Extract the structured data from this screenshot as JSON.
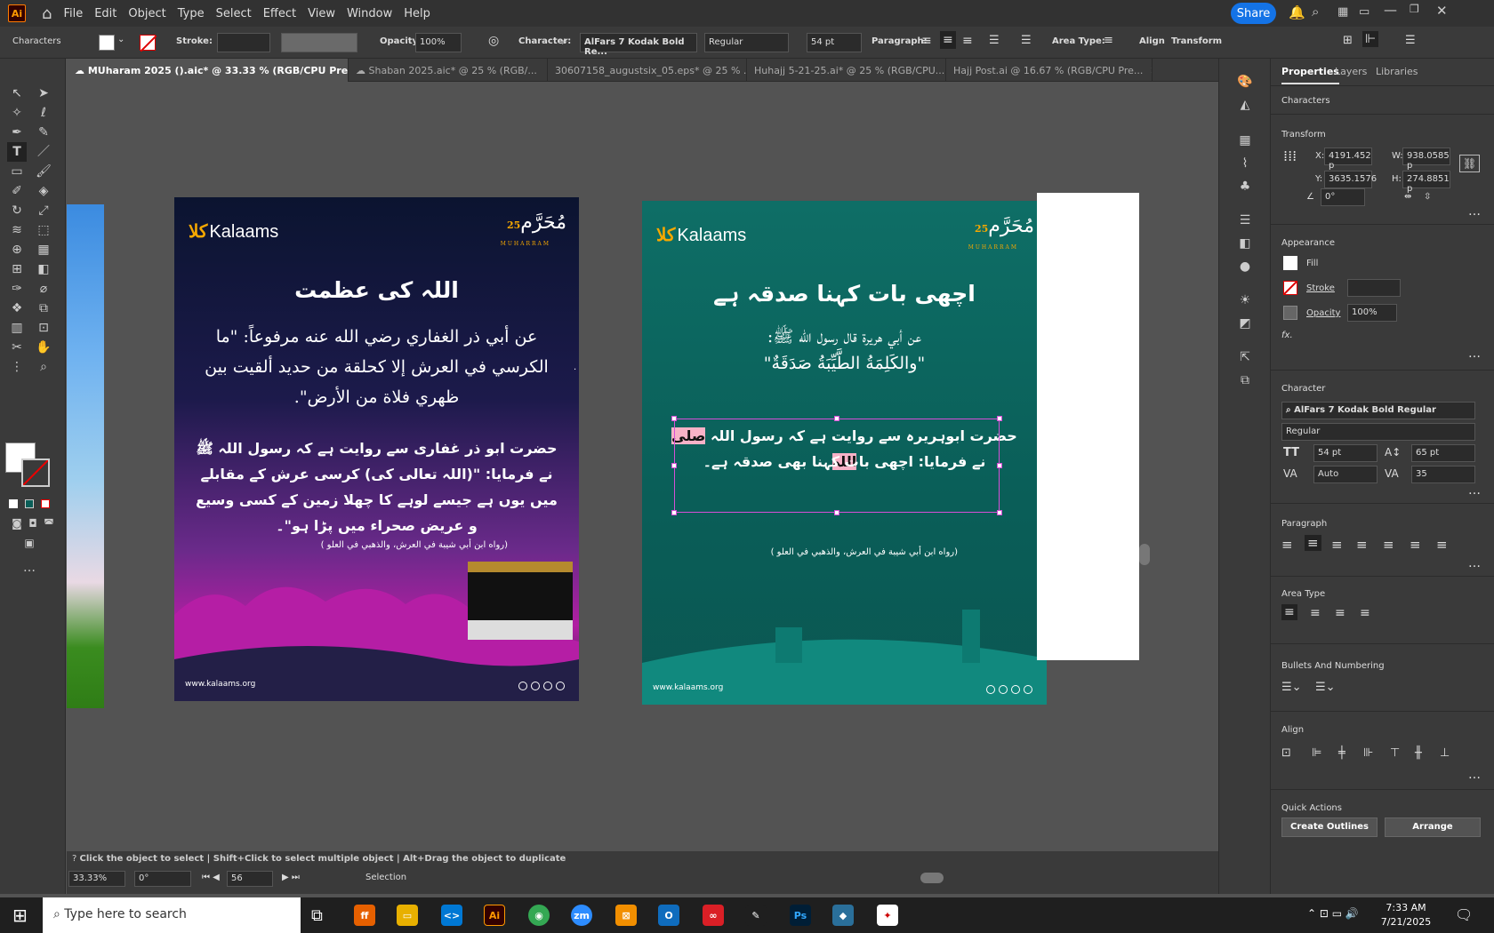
{
  "app": {
    "logo": "Ai",
    "menus": [
      "File",
      "Edit",
      "Object",
      "Type",
      "Select",
      "Effect",
      "View",
      "Window",
      "Help"
    ],
    "share": "Share"
  },
  "control": {
    "characters": "Characters",
    "stroke_label": "Stroke:",
    "opacity_label": "Opacity:",
    "opacity_value": "100%",
    "character_label": "Character:",
    "font_name": "AlFars 7 Kodak Bold Re...",
    "font_style": "Regular",
    "font_size": "54 pt",
    "paragraph_label": "Paragraph:",
    "area_type_label": "Area Type:",
    "align": "Align",
    "transform": "Transform"
  },
  "tabs": [
    {
      "label": "MUharam 2025 ().aic* @ 33.33 % (RGB/CPU Preview)"
    },
    {
      "label": "Shaban 2025.aic* @ 25 % (RGB/..."
    },
    {
      "label": "30607158_augustsix_05.eps* @ 25 % ..."
    },
    {
      "label": "Huhajj 5-21-25.ai* @ 25 % (RGB/CPU..."
    },
    {
      "label": "Hajj Post.ai @ 16.67 % (RGB/CPU Pre..."
    }
  ],
  "artboard1": {
    "logo": "Kalaams",
    "badge_num": "25",
    "badge_ar": "مُحَرَّم",
    "badge_en": "MUHARRAM",
    "title": "اللہ کی عظمت",
    "arabic": "عن أبي ذر الغفاري رضي الله عنه مرفوعاً: \"ما الكرسي في العرش إلا كحلقة من حديد ألقيت بين ظهري فلاة من الأرض\".",
    "urdu": "حضرت ابو ذر غفاری سے روایت ہے کہ رسول اللہ ﷺ نے فرمایا: \"(اللہ تعالی کی) کرسی عرش کے مقابلے میں یوں ہے جیسے لوہے کا چھلا زمین کے کسی وسیع و عریض صحراء میں پڑا ہو\"۔",
    "ref": "(رواه ابن أبي شيبة في العرش، والذهبي في العلو )",
    "site": "www.kalaams.org"
  },
  "artboard2": {
    "logo": "Kalaams",
    "badge_num": "25",
    "badge_ar": "مُحَرَّم",
    "badge_en": "MUHARRAM",
    "title": "اچھی بات کہنا صدقہ ہے",
    "arabic_1": "عن أبي هريرة قال رسول الله ﷺ:",
    "arabic_2": "\"والكَلِمَةُ الطَّيِّبَةُ صَدَقَةٌ\"",
    "urdu_sel": "صلی اللہ",
    "urdu_1": "حضرت ابوہریرہ سے روایت ہے کہ رسول اللہ",
    "urdu_2": "نے فرمایا: اچھی بات کہنا بھی صدقہ ہے۔",
    "ref": "(رواه ابن أبي شيبة في العرش، والذهبي في العلو )",
    "site": "www.kalaams.org"
  },
  "panel": {
    "tabs": [
      "Properties",
      "Layers",
      "Libraries"
    ],
    "characters": "Characters",
    "transform": "Transform",
    "x_label": "X:",
    "x": "4191.452 p",
    "y_label": "Y:",
    "y": "3635.1576",
    "w_label": "W:",
    "w": "938.0585 p",
    "h_label": "H:",
    "h": "274.8851 p",
    "angle": "0°",
    "appearance": "Appearance",
    "fill": "Fill",
    "stroke": "Stroke",
    "opacity": "Opacity",
    "opacity_val": "100%",
    "fx": "fx.",
    "character": "Character",
    "font": "AlFars 7 Kodak Bold Regular",
    "style": "Regular",
    "size": "54 pt",
    "leading": "65 pt",
    "kerning": "Auto",
    "tracking": "35",
    "paragraph": "Paragraph",
    "area_type": "Area Type",
    "bullets": "Bullets And Numbering",
    "align": "Align",
    "quick_actions": "Quick Actions",
    "create_outlines": "Create Outlines",
    "arrange": "Arrange"
  },
  "status": {
    "hint": "Click the object to select  |  Shift+Click to select multiple object  |  Alt+Drag the object to duplicate",
    "zoom": "33.33%",
    "rotate": "0°",
    "artboard": "56",
    "mode": "Selection"
  },
  "taskbar": {
    "search": "Type here to search",
    "time": "7:33 AM",
    "date": "7/21/2025"
  }
}
